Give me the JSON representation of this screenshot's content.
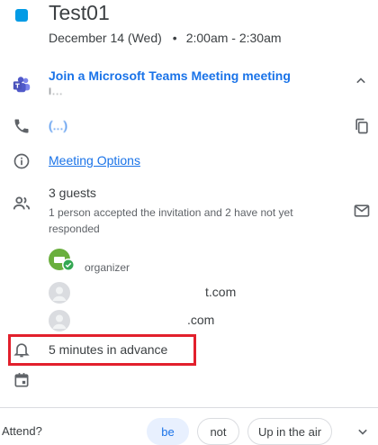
{
  "event": {
    "title": "Test01",
    "date": "December 14 (Wed)",
    "separator": "•",
    "time": "2:00am - 2:30am",
    "color": "#039be5"
  },
  "conference": {
    "title": "Join a Microsoft Teams Meeting meeting",
    "id_partial": "I...",
    "phone_partial": "(...)"
  },
  "links": {
    "meeting_options": "Meeting Options"
  },
  "guests": {
    "count_label": "3 guests",
    "summary": "1 person accepted the invitation and 2 have not yet responded",
    "list": [
      {
        "name_partial": "",
        "role": "organizer"
      },
      {
        "name_partial": "t.com",
        "role": ""
      },
      {
        "name_partial": ".com",
        "role": ""
      }
    ]
  },
  "reminder": {
    "text": "5 minutes in advance",
    "highlight_color": "#e2202c"
  },
  "footer": {
    "attend_label": "Attend?",
    "options": [
      "be",
      "not",
      "Up in the air"
    ],
    "selected": "be"
  },
  "icons": [
    "teams-icon",
    "phone-icon",
    "info-icon",
    "people-icon",
    "bell-icon",
    "calendar-icon",
    "copy-icon",
    "mail-icon",
    "chevron-up-icon",
    "chevron-down-icon"
  ]
}
